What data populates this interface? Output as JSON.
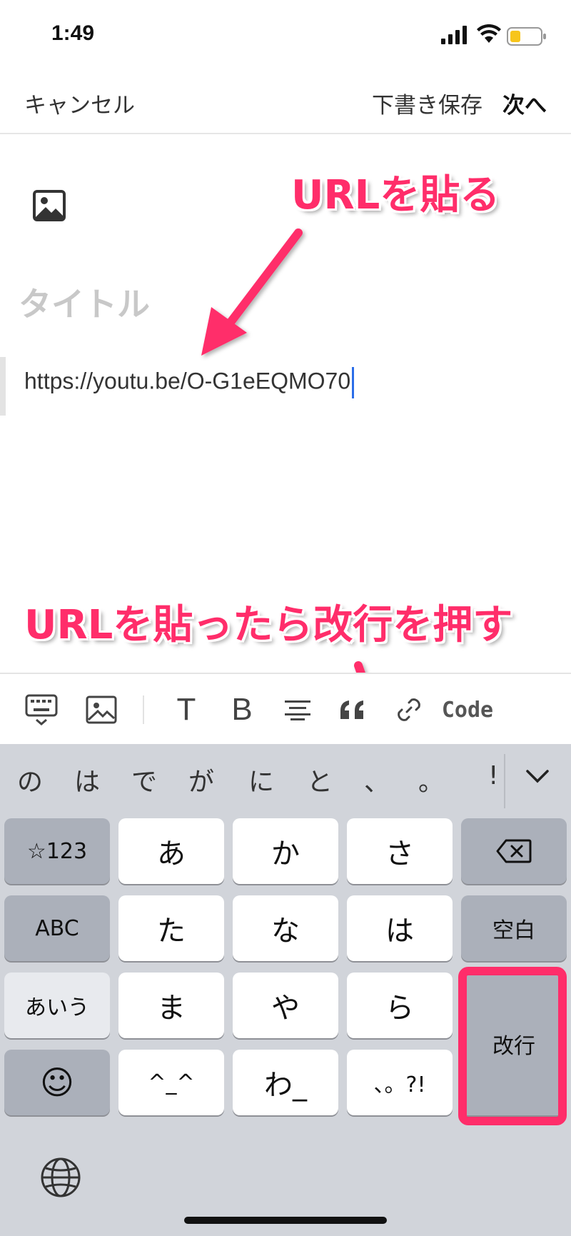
{
  "status": {
    "time": "1:49"
  },
  "nav": {
    "cancel": "キャンセル",
    "draft": "下書き保存",
    "next": "次へ"
  },
  "editor": {
    "title_placeholder": "タイトル",
    "body_text": "https://youtu.be/O-G1eEQMO70"
  },
  "annotations": {
    "paste_url": "URLを貼る",
    "press_enter": "URLを貼ったら改行を押す"
  },
  "toolbar": {
    "items": [
      "keyboard-icon",
      "image-icon",
      "T",
      "B",
      "align-icon",
      "quote-icon",
      "link-icon",
      "Code"
    ],
    "code_label": "Code",
    "text_label": "T",
    "bold_label": "B"
  },
  "keyboard": {
    "suggestions": [
      "の",
      "は",
      "で",
      "が",
      "に",
      "と",
      "、",
      "。",
      "!"
    ],
    "keys": {
      "num": "☆123",
      "a": "あ",
      "ka": "か",
      "sa": "さ",
      "abc": "ABC",
      "ta": "た",
      "na": "な",
      "ha": "は",
      "space": "空白",
      "kana": "あいう",
      "ma": "ま",
      "ya": "や",
      "ra": "ら",
      "enter": "改行",
      "emoji": "☺",
      "kaomoji": "^_^",
      "wa": "わ_",
      "punct": "、。?!"
    }
  },
  "colors": {
    "accent": "#ff2d6a",
    "caret": "#2b6de8"
  }
}
